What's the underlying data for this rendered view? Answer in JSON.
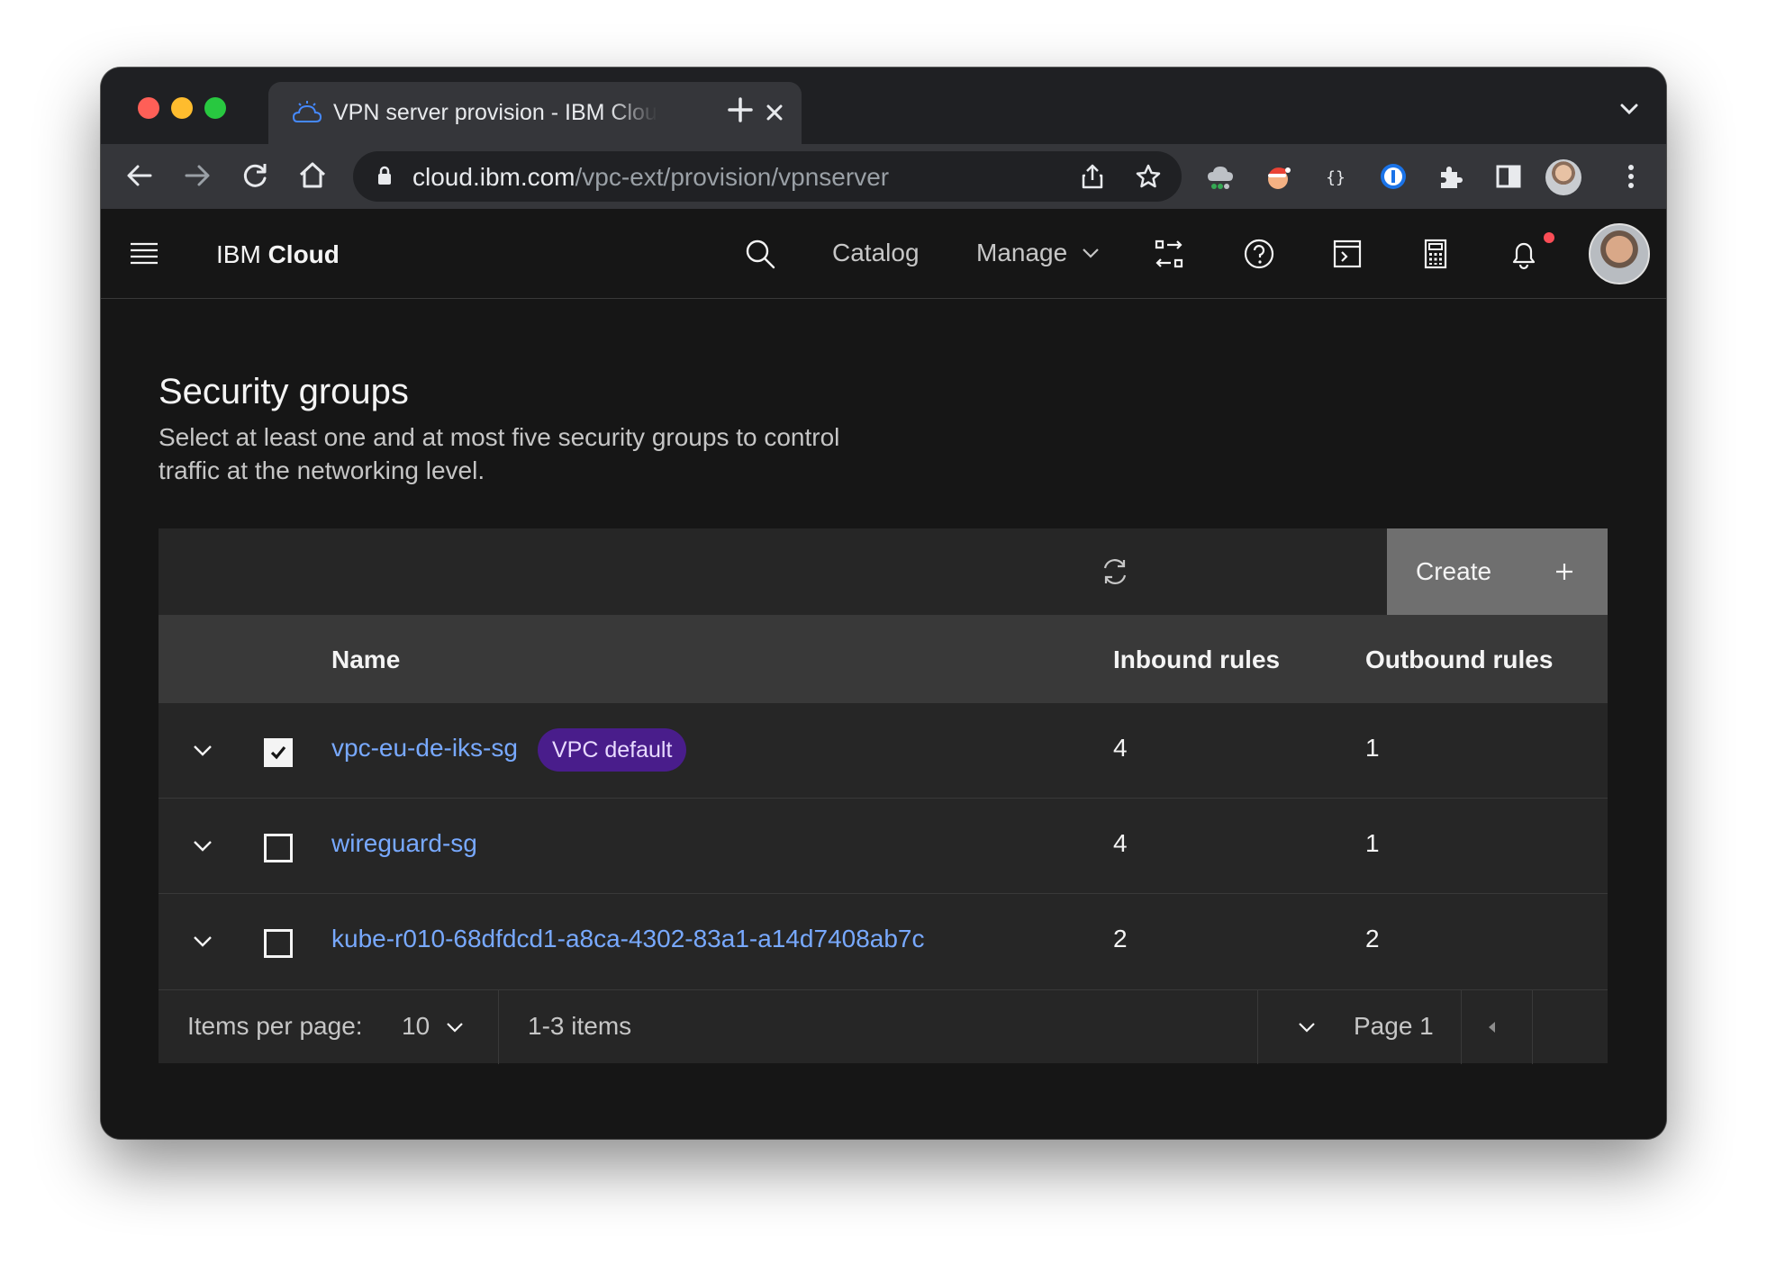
{
  "browser": {
    "tab": {
      "title": "VPN server provision - IBM Cloud"
    },
    "address": {
      "host": "cloud.ibm.com",
      "path": "/vpc-ext/provision/vpnserver"
    }
  },
  "header": {
    "brand_prefix": "IBM",
    "brand_name": "Cloud",
    "nav": {
      "catalog": "Catalog",
      "manage": "Manage"
    }
  },
  "section": {
    "title": "Security groups",
    "description": "Select at least one and at most five security groups to control traffic at the networking level."
  },
  "table": {
    "create_label": "Create",
    "columns": {
      "name": "Name",
      "inbound": "Inbound rules",
      "outbound": "Outbound rules"
    },
    "rows": [
      {
        "name": "vpc-eu-de-iks-sg",
        "tag": "VPC default",
        "inbound": "4",
        "outbound": "1",
        "checked": true
      },
      {
        "name": "wireguard-sg",
        "inbound": "4",
        "outbound": "1",
        "checked": false
      },
      {
        "name": "kube-r010-68dfdcd1-a8ca-4302-83a1-a14d7408ab7c",
        "inbound": "2",
        "outbound": "2",
        "checked": false
      }
    ],
    "pagination": {
      "items_per_page_label": "Items per page:",
      "items_per_page_value": "10",
      "range": "1-3 items",
      "page": "Page 1"
    }
  },
  "colors": {
    "accent": "#0f62fe",
    "link": "#78a9ff",
    "tag_bg": "#491d8b",
    "notification": "#fa4d56"
  }
}
